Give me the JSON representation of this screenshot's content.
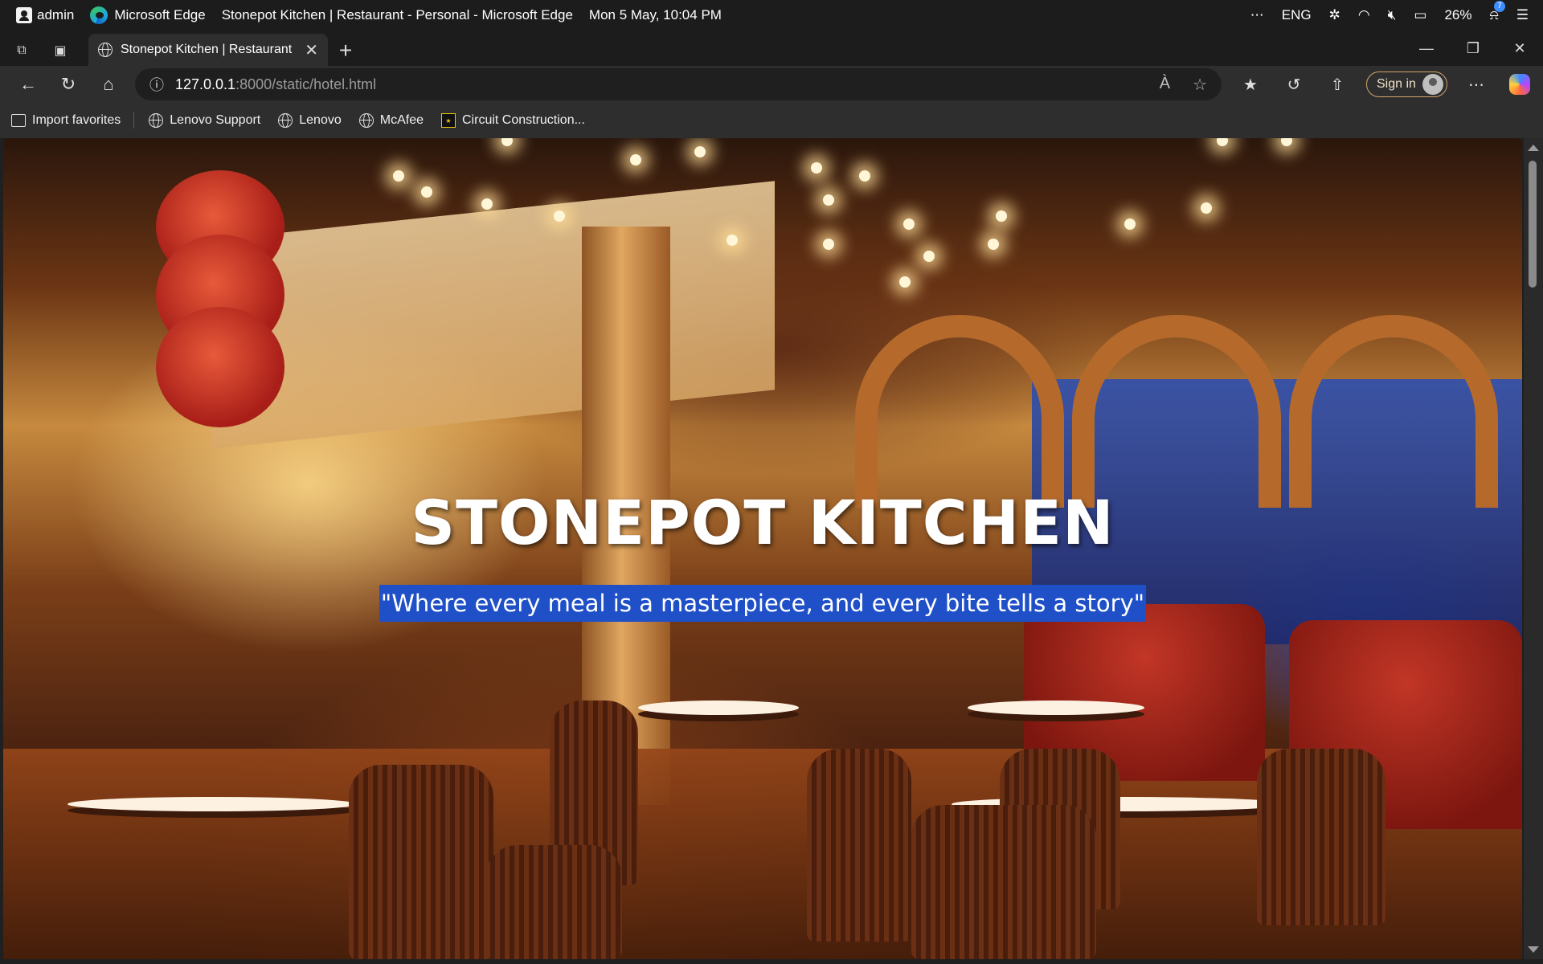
{
  "os": {
    "user": "admin",
    "app": "Microsoft Edge",
    "window_title": "Stonepot Kitchen | Restaurant - Personal - Microsoft Edge",
    "datetime": "Mon 5 May, 10:04 PM",
    "overflow": "⋯",
    "language": "ENG",
    "battery": "26%",
    "notifications": "7"
  },
  "tabs": [
    {
      "title": "Stonepot Kitchen | Restaurant",
      "active": true
    }
  ],
  "address": {
    "host": "127.0.0.1",
    "path": ":8000/static/hotel.html"
  },
  "toolbar": {
    "signin_label": "Sign in",
    "more": "⋯"
  },
  "favorites": [
    {
      "label": "Import favorites",
      "icon": "import-icon"
    },
    {
      "label": "Lenovo Support",
      "icon": "globe-icon"
    },
    {
      "label": "Lenovo",
      "icon": "globe-icon"
    },
    {
      "label": "McAfee",
      "icon": "globe-icon"
    },
    {
      "label": "Circuit Construction...",
      "icon": "phet-icon"
    }
  ],
  "hero": {
    "title": "STONEPOT KITCHEN",
    "tagline": "\"Where every meal is a masterpiece, and every bite tells a story\""
  },
  "colors": {
    "accent_selection": "#1f50c8",
    "chrome_dark": "#1c1c1c",
    "chrome_mid": "#2e2e2e",
    "signin_border": "#d4a46a"
  }
}
